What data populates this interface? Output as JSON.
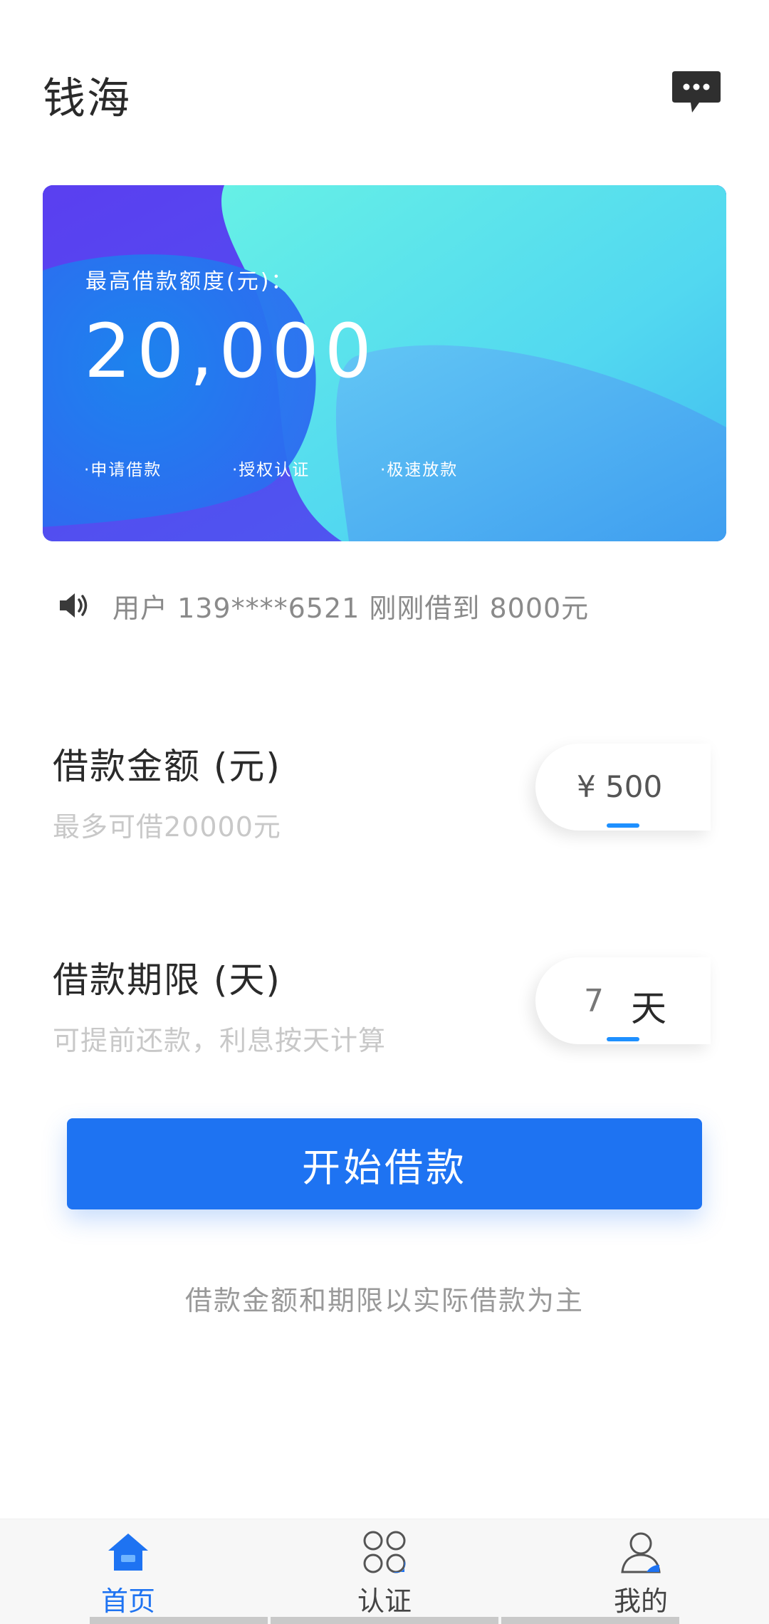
{
  "header": {
    "title": "钱海",
    "message_icon": "chat-bubble-icon"
  },
  "banner": {
    "label": "最高借款额度(元)：",
    "amount": "20,000",
    "features": [
      "·申请借款",
      "·授权认证",
      "·极速放款"
    ]
  },
  "notice": {
    "icon": "speaker-icon",
    "text": "用户 139****6521 刚刚借到 8000元"
  },
  "loan_amount": {
    "title": "借款金额 (元)",
    "subtitle": "最多可借20000元",
    "value": "¥ 500"
  },
  "loan_term": {
    "title": "借款期限 (天)",
    "subtitle": "可提前还款，利息按天计算",
    "value": "7",
    "unit": "天"
  },
  "actions": {
    "start_label": "开始借款"
  },
  "disclaimer": "借款金额和期限以实际借款为主",
  "bottom_nav": {
    "items": [
      {
        "label": "首页",
        "icon": "home-icon",
        "active": true
      },
      {
        "label": "认证",
        "icon": "grid-icon",
        "active": false
      },
      {
        "label": "我的",
        "icon": "user-icon",
        "active": false
      }
    ]
  },
  "colors": {
    "accent": "#1e73f2",
    "title_text": "#2a2a2a",
    "muted_text": "#c8c8c8"
  }
}
